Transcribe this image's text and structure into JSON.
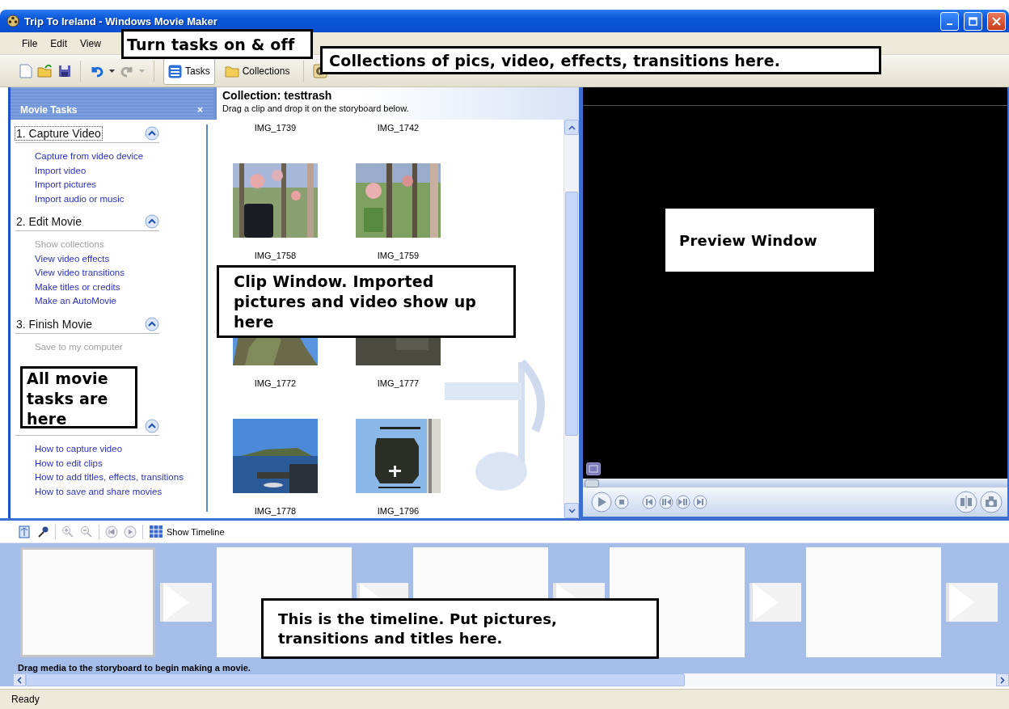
{
  "window": {
    "title": "Trip To Ireland - Windows Movie Maker"
  },
  "menu": [
    "File",
    "Edit",
    "View"
  ],
  "toolbar": {
    "buttons": [
      {
        "label": "Tasks",
        "selected": true
      },
      {
        "label": "Collections",
        "selected": false
      }
    ]
  },
  "tasks_pane": {
    "title": "Movie Tasks",
    "close": "×",
    "sections": [
      {
        "title": "1. Capture Video",
        "focused": true,
        "expanded": true,
        "items": [
          {
            "label": "Capture from video device",
            "disabled": false
          },
          {
            "label": "Import video",
            "disabled": false
          },
          {
            "label": "Import pictures",
            "disabled": false
          },
          {
            "label": "Import audio or music",
            "disabled": false
          }
        ]
      },
      {
        "title": "2. Edit Movie",
        "focused": false,
        "expanded": true,
        "items": [
          {
            "label": "Show collections",
            "disabled": true
          },
          {
            "label": "View video effects",
            "disabled": false
          },
          {
            "label": "View video transitions",
            "disabled": false
          },
          {
            "label": "Make titles or credits",
            "disabled": false
          },
          {
            "label": "Make an AutoMovie",
            "disabled": false
          }
        ]
      },
      {
        "title": "3. Finish Movie",
        "focused": false,
        "expanded": true,
        "items": [
          {
            "label": "Save to my computer",
            "disabled": true
          }
        ]
      },
      {
        "focused": false,
        "expanded": true,
        "items": [
          {
            "label": "How to capture video",
            "disabled": false
          },
          {
            "label": "How to edit clips",
            "disabled": false
          },
          {
            "label": "How to add titles, effects, transitions",
            "disabled": false
          },
          {
            "label": "How to save and share movies",
            "disabled": false
          }
        ]
      }
    ]
  },
  "collection": {
    "title": "Collection: testtrash",
    "hint": "Drag a clip and drop it on the storyboard below.",
    "clips": [
      {
        "name": "IMG_1739",
        "kind": "label"
      },
      {
        "name": "IMG_1742",
        "kind": "label"
      },
      {
        "name": "IMG_1758",
        "kind": "picture"
      },
      {
        "name": "IMG_1759",
        "kind": "picture"
      },
      {
        "name": "IMG_1772",
        "kind": "picture"
      },
      {
        "name": "IMG_1777",
        "kind": "picture"
      },
      {
        "name": "IMG_1778",
        "kind": "picture"
      },
      {
        "name": "IMG_1796",
        "kind": "picture"
      }
    ]
  },
  "preview": {
    "seek": {
      "level": 0
    }
  },
  "storyboard": {
    "toolbar_button": "Show Timeline",
    "message": "Drag media to the storyboard to begin making a movie.",
    "slots": [
      {
        "selected": true
      },
      {
        "selected": false
      },
      {
        "selected": false
      },
      {
        "selected": false
      },
      {
        "selected": false
      }
    ]
  },
  "status_bar": "Ready",
  "annotations": [
    {
      "text": "Turn tasks on & off"
    },
    {
      "text": "Collections of pics, video, effects, transitions here."
    },
    {
      "text": "All movie tasks are here"
    },
    {
      "text": "Clip Window. Imported pictures and video show up here"
    },
    {
      "text": "Preview Window"
    },
    {
      "text": "This is the timeline. Put pictures, transitions and titles here."
    }
  ]
}
